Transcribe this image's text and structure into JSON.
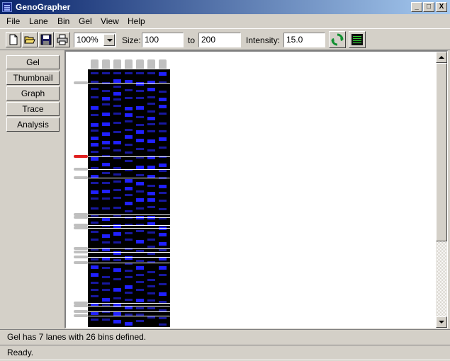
{
  "window": {
    "title": "GenoGrapher"
  },
  "titlebar_buttons": {
    "minimize": "_",
    "maximize": "□",
    "close": "X"
  },
  "menu": [
    "File",
    "Lane",
    "Bin",
    "Gel",
    "View",
    "Help"
  ],
  "toolbar": {
    "zoom": "100%",
    "size_label": "Size:",
    "size_from": "100",
    "to_label": "to",
    "size_to": "200",
    "intensity_label": "Intensity:",
    "intensity": "15.0",
    "icons": [
      "new-file-icon",
      "open-folder-icon",
      "save-disk-icon",
      "print-icon",
      "refresh-icon",
      "gel-view-icon"
    ]
  },
  "nav": [
    "Gel",
    "Thumbnail",
    "Graph",
    "Trace",
    "Analysis"
  ],
  "gel": {
    "lanes": 7,
    "bins": 26,
    "lane_color": "#c0c0c0",
    "band_color": "#2020ff",
    "bin_color": "#ffffff",
    "selected_bin_color": "#e02020",
    "marker_color": "#bfbfbf"
  },
  "status": {
    "info": "Gel has 7 lanes with 26 bins defined.",
    "ready": "Ready."
  },
  "colors": {
    "titlebar": "#0a246a",
    "face": "#d4d0c8"
  }
}
